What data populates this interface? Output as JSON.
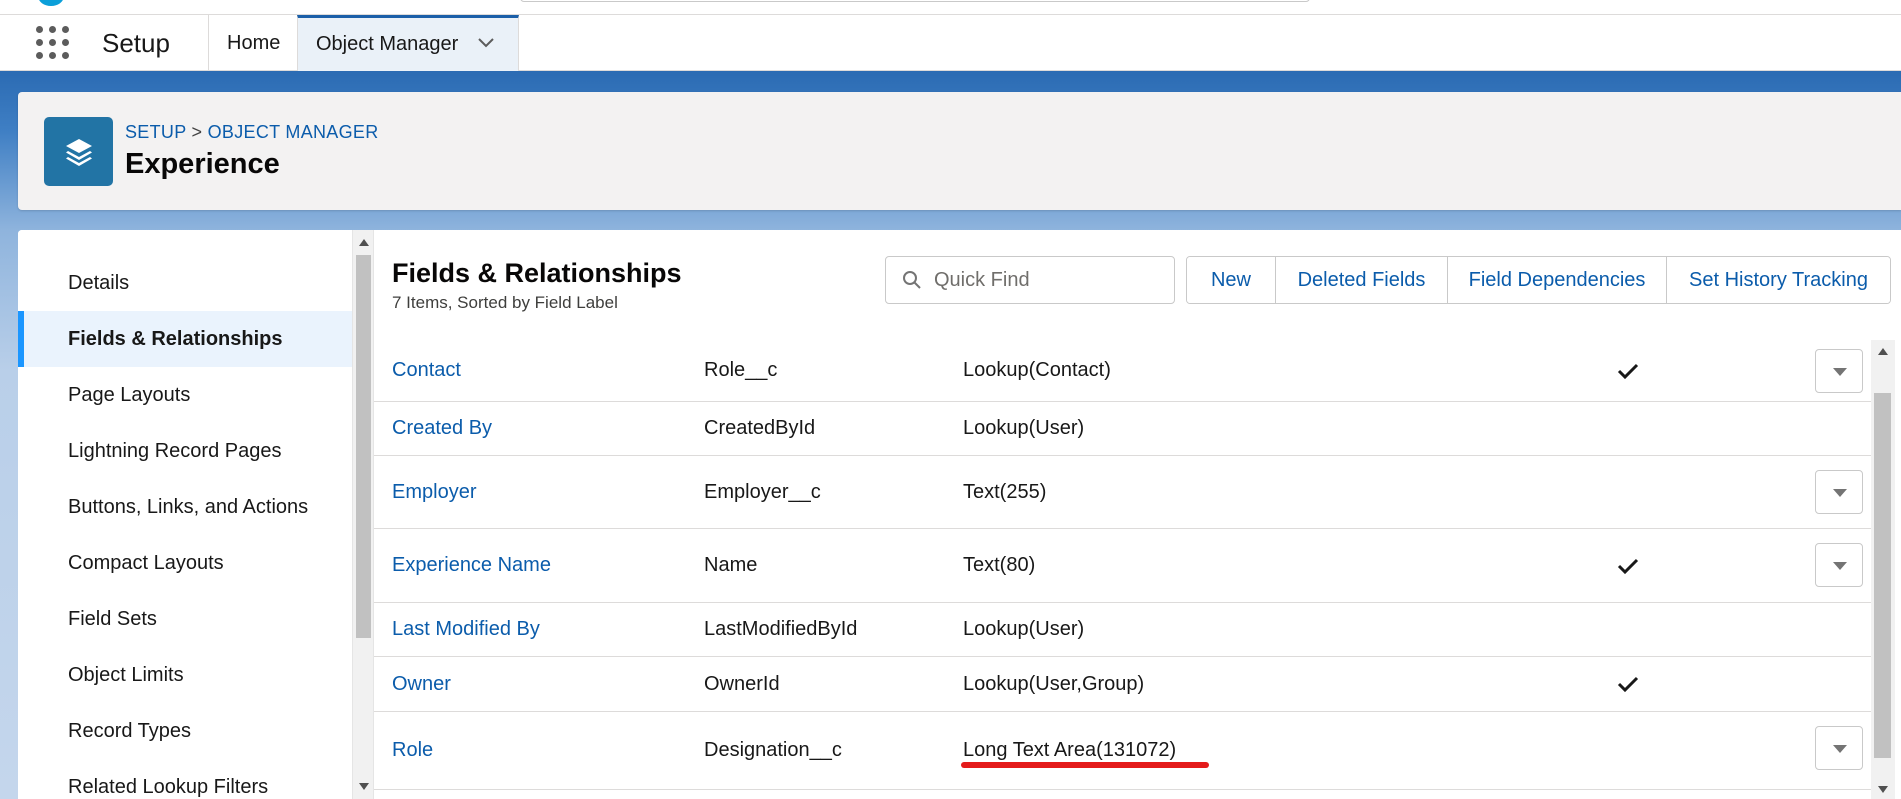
{
  "app": {
    "name": "Setup",
    "tabs": [
      {
        "label": "Home"
      },
      {
        "label": "Object Manager"
      }
    ]
  },
  "header": {
    "breadcrumb": {
      "setup": "SETUP",
      "separator": ">",
      "object_manager": "OBJECT MANAGER"
    },
    "title": "Experience"
  },
  "sidebar": {
    "items": [
      {
        "label": "Details"
      },
      {
        "label": "Fields & Relationships",
        "active": true
      },
      {
        "label": "Page Layouts"
      },
      {
        "label": "Lightning Record Pages"
      },
      {
        "label": "Buttons, Links, and Actions"
      },
      {
        "label": "Compact Layouts"
      },
      {
        "label": "Field Sets"
      },
      {
        "label": "Object Limits"
      },
      {
        "label": "Record Types"
      },
      {
        "label": "Related Lookup Filters"
      }
    ]
  },
  "main": {
    "title": "Fields & Relationships",
    "subtitle": "7 Items, Sorted by Field Label",
    "quick_find": {
      "placeholder": "Quick Find",
      "value": ""
    },
    "buttons": {
      "new": "New",
      "deleted_fields": "Deleted Fields",
      "field_dependencies": "Field Dependencies",
      "set_history_tracking": "Set History Tracking"
    },
    "rows": [
      {
        "label": "Contact",
        "api_name": "Role__c",
        "data_type": "Lookup(Contact)",
        "indexed": true,
        "has_menu": true
      },
      {
        "label": "Created By",
        "api_name": "CreatedById",
        "data_type": "Lookup(User)",
        "indexed": false,
        "has_menu": false
      },
      {
        "label": "Employer",
        "api_name": "Employer__c",
        "data_type": "Text(255)",
        "indexed": false,
        "has_menu": true
      },
      {
        "label": "Experience Name",
        "api_name": "Name",
        "data_type": "Text(80)",
        "indexed": true,
        "has_menu": true
      },
      {
        "label": "Last Modified By",
        "api_name": "LastModifiedById",
        "data_type": "Lookup(User)",
        "indexed": false,
        "has_menu": false
      },
      {
        "label": "Owner",
        "api_name": "OwnerId",
        "data_type": "Lookup(User,Group)",
        "indexed": true,
        "has_menu": false
      },
      {
        "label": "Role",
        "api_name": "Designation__c",
        "data_type": "Long Text Area(131072)",
        "indexed": false,
        "has_menu": true,
        "highlighted": true
      }
    ]
  },
  "colors": {
    "link": "#0b5cab",
    "brand_blue": "#2b6bb3",
    "object_icon": "#2274a5",
    "highlight": "#e41b1b"
  },
  "icons": {
    "app_launcher": "waffle-icon",
    "object": "layers-icon",
    "search": "search-icon",
    "check": "check-icon",
    "row_menu": "chevron-down-icon"
  }
}
